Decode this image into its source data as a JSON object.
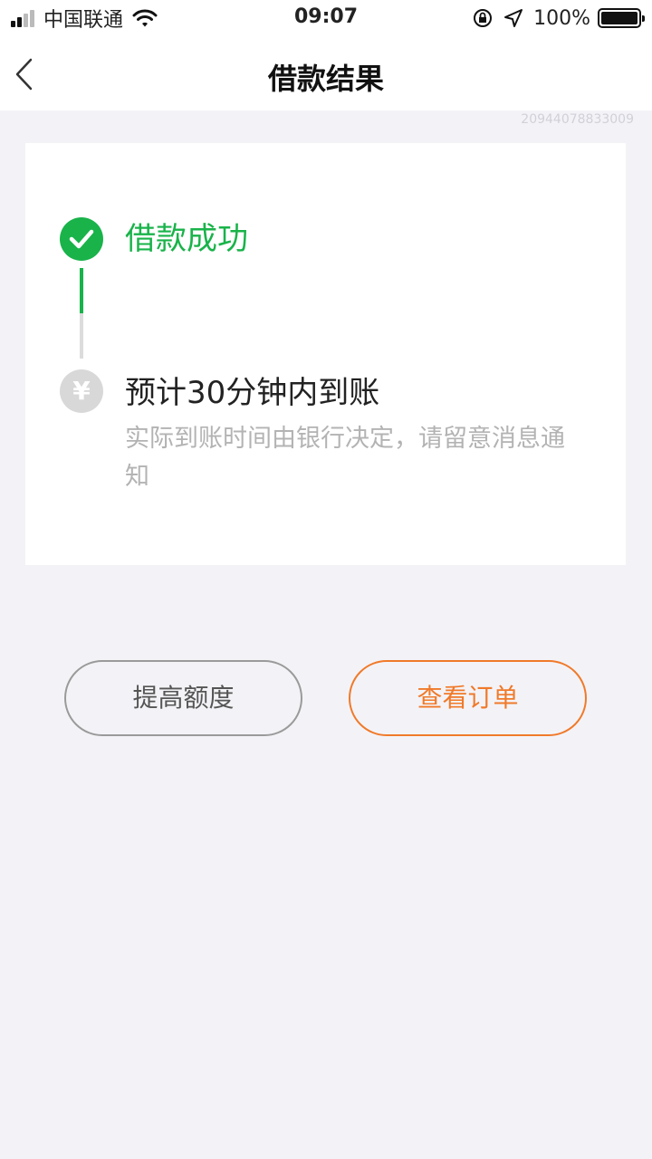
{
  "status_bar": {
    "carrier": "中国联通",
    "time": "09:07",
    "battery": "100%"
  },
  "nav": {
    "title": "借款结果",
    "back_icon": "chevron-left-icon"
  },
  "order_id": "20944078833009",
  "steps": [
    {
      "icon": "check-icon",
      "title": "借款成功",
      "state": "done"
    },
    {
      "icon": "yuan-icon",
      "glyph": "¥",
      "title": "预计30分钟内到账",
      "desc": "实际到账时间由银行决定，请留意消息通知",
      "state": "pending"
    }
  ],
  "buttons": {
    "raise_limit": "提高额度",
    "view_order": "查看订单"
  },
  "colors": {
    "success": "#19b34a",
    "accent": "#f07a2a",
    "pending": "#d8d8d8"
  }
}
